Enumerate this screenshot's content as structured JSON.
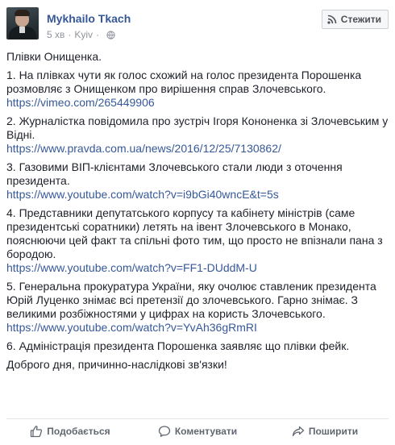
{
  "post": {
    "author": "Mykhailo Tkach",
    "time": "5 хв",
    "location": "Kyiv",
    "follow_label": "Стежити",
    "privacy_icon": "globe-icon"
  },
  "body": {
    "intro": "Плівки Онищенка.",
    "items": [
      {
        "text": "1. На плівках чути як голос схожий на голос президента Порошенка розмовляє з Онищенком про вирішення справ Злочевського.",
        "link": "https://vimeo.com/265449906"
      },
      {
        "text": "2. Журналістка повідомила про зустріч Ігоря Кононенка зі Злочевським у Відні.",
        "link": "https://www.pravda.com.ua/news/2016/12/25/7130862/"
      },
      {
        "text": "3. Газовими ВІП-клієнтами Злочевського стали люди з оточення президента.",
        "link": "https://www.youtube.com/watch?v=i9bGi40wncE&t=5s"
      },
      {
        "text": "4. Представники депутатського корпусу та кабінету міністрів (саме президентські соратники) летять на івент Злочевського в Монако, пояснюючи цей факт та спільні фото тим, що просто не впізнали пана з бородою.",
        "link": "https://www.youtube.com/watch?v=FF1-DUddM-U"
      },
      {
        "text": "5. Генеральна прокуратура України, яку очолює ставленик президента Юрій Луценко знімає всі претензії до злочевського. Гарно знімає. З великими розбіжностями у цифрах на користь Злочевського.",
        "link": "https://www.youtube.com/watch?v=YvAh36gRmRI"
      }
    ],
    "item6": "6. Адміністрація президента Порошенка заявляє що плівки фейк.",
    "outro": "Доброго дня, причинно-наслідкові зв'язки!"
  },
  "actions": {
    "like": "Подобається",
    "comment": "Коментувати",
    "share": "Поширити"
  },
  "colors": {
    "link": "#365899",
    "text": "#1d2129",
    "muted": "#90949c",
    "action": "#606770"
  }
}
